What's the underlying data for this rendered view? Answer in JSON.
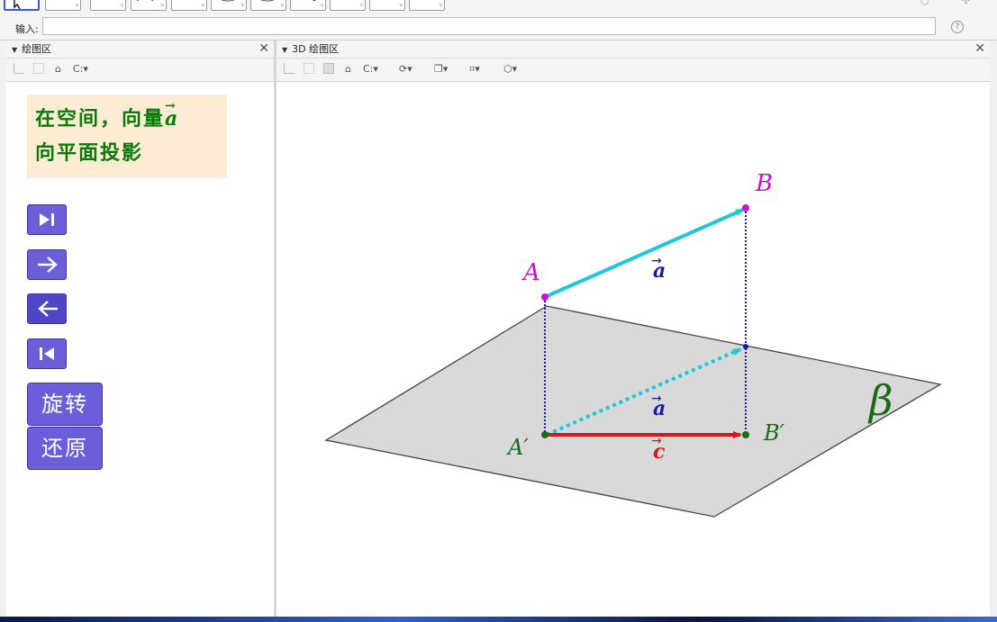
{
  "input_bar": {
    "label": "输入:",
    "value": "",
    "help": "?"
  },
  "left_panel": {
    "title": "绘图区",
    "close": "✕",
    "coord_toggle": "C:"
  },
  "right_panel": {
    "title": "3D 绘图区",
    "close": "✕",
    "coord_toggle": "C:"
  },
  "info_box": {
    "line1": "在空间，向量",
    "vec": "a",
    "line2": "向平面投影",
    "bg_color": "#fdecd4",
    "text_color": "#0a7a0a"
  },
  "nav_buttons": [
    {
      "name": "play-to-end",
      "icon": "skip-end-icon"
    },
    {
      "name": "next-step",
      "icon": "arrow-right-icon"
    },
    {
      "name": "prev-step",
      "icon": "arrow-left-icon"
    },
    {
      "name": "go-to-start",
      "icon": "skip-start-icon"
    }
  ],
  "text_buttons": {
    "rotate": "旋转",
    "reset": "还原"
  },
  "scene": {
    "points": {
      "A": "A",
      "B": "B",
      "A_prime": "A′",
      "B_prime": "B′"
    },
    "vectors": {
      "a_top": "a",
      "a_proj": "a",
      "c": "c"
    },
    "plane_label": "β",
    "colors": {
      "vector_a": "#1ec8d8",
      "vector_c": "#d81818",
      "point_upper": "#cc10cc",
      "point_lower": "#1a6a1a",
      "label_vec": "#1a1aa8",
      "plane": "#d9d9d9",
      "plane_label": "#1a6a1a",
      "dotted_line": "#1a1aa8"
    }
  }
}
